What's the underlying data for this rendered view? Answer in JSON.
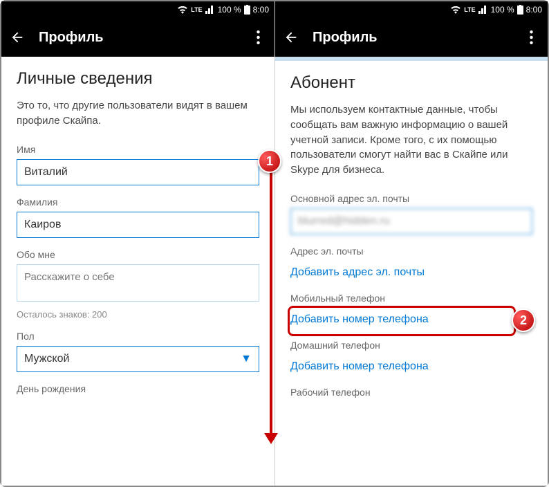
{
  "status": {
    "battery": "100 %",
    "time": "8:00",
    "lte": "LTE"
  },
  "appbar": {
    "title": "Профиль"
  },
  "screen1": {
    "heading": "Личные сведения",
    "description": "Это то, что другие пользователи видят в вашем профиле Скайпа.",
    "firstname_label": "Имя",
    "firstname_value": "Виталий",
    "lastname_label": "Фамилия",
    "lastname_value": "Каиров",
    "about_label": "Обо мне",
    "about_placeholder": "Расскажите о себе",
    "about_counter": "Осталось знаков: 200",
    "gender_label": "Пол",
    "gender_value": "Мужской",
    "birthday_label": "День рождения"
  },
  "screen2": {
    "heading": "Абонент",
    "description": "Мы используем контактные данные, чтобы сообщать вам важную информацию о вашей учетной записи. Кроме того, с их помощью пользователи смогут найти вас в Скайпе или Skype для бизнеса.",
    "primary_email_label": "Основной адрес эл. почты",
    "primary_email_value": "blurred@hidden.ru",
    "email_label": "Адрес эл. почты",
    "add_email": "Добавить адрес эл. почты",
    "mobile_label": "Мобильный телефон",
    "add_mobile": "Добавить номер телефона",
    "home_label": "Домашний телефон",
    "add_home": "Добавить номер телефона",
    "work_label": "Рабочий телефон"
  },
  "callouts": {
    "one": "1",
    "two": "2"
  }
}
